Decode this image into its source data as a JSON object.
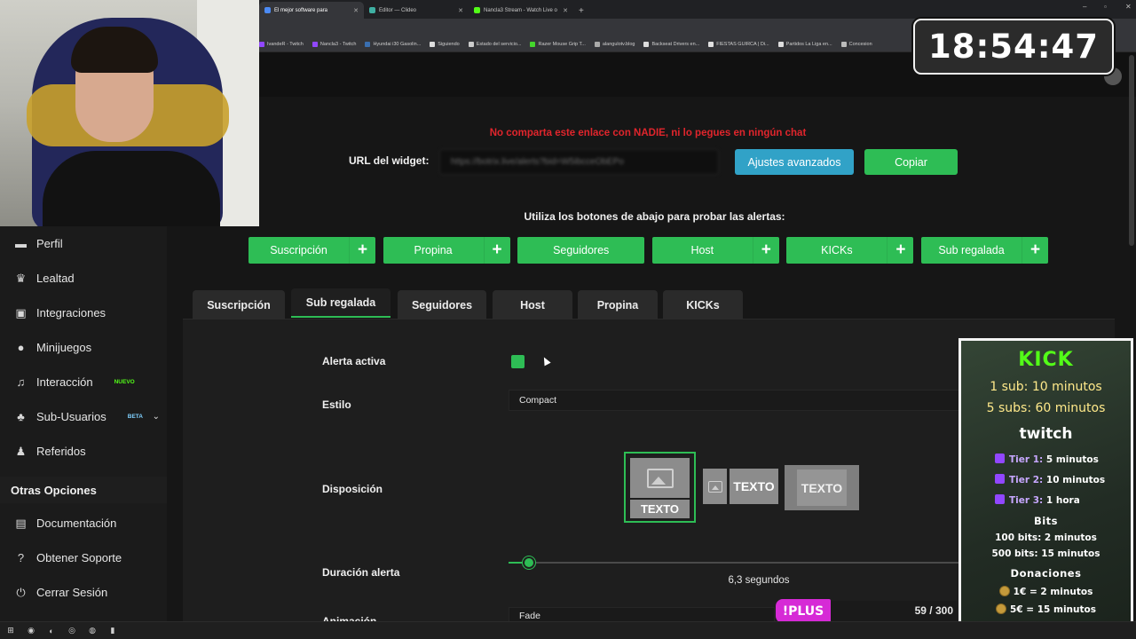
{
  "browser": {
    "tabs": [
      {
        "label": "El mejor software para",
        "color": "#4c8bf5",
        "active": true
      },
      {
        "label": "Editor — Clideo",
        "color": "#3fb0a3",
        "active": false
      },
      {
        "label": "Nancla3 Stream - Watch Live o",
        "color": "#53fc18",
        "active": false
      }
    ],
    "new_tab": "+",
    "window_controls": [
      "–",
      "▫",
      "✕"
    ]
  },
  "bookmarks": [
    {
      "label": "IvandeR - Twitch",
      "color": "#9147ff"
    },
    {
      "label": "Nancla3 - Twitch",
      "color": "#9147ff"
    },
    {
      "label": "Hyundai i30 Gasolin...",
      "color": "#3a6fb0"
    },
    {
      "label": "Siguiendo",
      "color": "#dddddd"
    },
    {
      "label": "Estado del servicio...",
      "color": "#cccccc"
    },
    {
      "label": "Razer Mouse Grip T...",
      "color": "#44d62c"
    },
    {
      "label": "alangulotv.blog",
      "color": "#aaaaaa"
    },
    {
      "label": "Backseat Drivers en...",
      "color": "#dddddd"
    },
    {
      "label": "FIESTAS GUIRCA | Di...",
      "color": "#e0e0e0"
    },
    {
      "label": "Partidos La Liga en...",
      "color": "#dddddd"
    },
    {
      "label": "Concesion",
      "color": "#bbbbbb"
    }
  ],
  "sidebar": {
    "items": [
      {
        "label": "Perfil",
        "icon": "id-card-icon",
        "glyph": "▬"
      },
      {
        "label": "Lealtad",
        "icon": "trophy-icon",
        "glyph": "♛"
      },
      {
        "label": "Integraciones",
        "icon": "plug-icon",
        "glyph": "▣"
      },
      {
        "label": "Minijuegos",
        "icon": "gamepad-icon",
        "glyph": "●"
      },
      {
        "label": "Interacción",
        "icon": "music-icon",
        "glyph": "♫",
        "badge": "NUEVO"
      },
      {
        "label": "Sub-Usuarios",
        "icon": "users-icon",
        "glyph": "♣",
        "badge": "BETA",
        "expandable": true
      },
      {
        "label": "Referidos",
        "icon": "user-group-icon",
        "glyph": "♟"
      }
    ],
    "section_title": "Otras Opciones",
    "bottom_items": [
      {
        "label": "Documentación",
        "icon": "document-icon",
        "glyph": "▤"
      },
      {
        "label": "Obtener Soporte",
        "icon": "question-circle-icon",
        "glyph": "?"
      },
      {
        "label": "Cerrar Sesión",
        "icon": "power-icon",
        "glyph": "⏻"
      }
    ]
  },
  "widget": {
    "warning": "No comparta este enlace con NADIE, ni lo pegues en ningún chat",
    "url_label": "URL del widget:",
    "url_value": "https://botrix.live/alerts?bid=W5ibcceObEPo",
    "advanced_button": "Ajustes avanzados",
    "copy_button": "Copiar",
    "test_hint": "Utiliza los botones de abajo para probar las alertas:"
  },
  "test_buttons": [
    "Suscripción",
    "Propina",
    "Seguidores",
    "Host",
    "KICKs",
    "Sub regalada"
  ],
  "alert_tabs": [
    "Suscripción",
    "Sub regalada",
    "Seguidores",
    "Host",
    "Propina",
    "KICKs"
  ],
  "active_alert_tab": "Sub regalada",
  "settings": {
    "active_label": "Alerta activa",
    "active_checked": true,
    "style_label": "Estilo",
    "style_value": "Compact",
    "layout_label": "Disposición",
    "layout_text": "TEXTO",
    "layout_selected": 0,
    "duration_label": "Duración alerta",
    "duration_value": 6.3,
    "duration_display": "6,3  segundos",
    "duration_fraction": 0.045,
    "animation_label": "Animación",
    "animation_value": "Fade"
  },
  "overlay": {
    "clock": "18:54:47",
    "kick_title": "KICK",
    "kick_line1": "1 sub: 10 minutos",
    "kick_line2": "5 subs: 60 minutos",
    "twitch_title": "twitch",
    "tier1": "Tier 1:",
    "tier1_val": " 5 minutos",
    "tier2": "Tier 2:",
    "tier2_val": " 10 minutos",
    "tier3": "Tier 3:",
    "tier3_val": " 1 hora",
    "bits_title": "Bits",
    "bits1": "100 bits: 2 minutos",
    "bits2": "500 bits: 15 minutos",
    "donations_title": "Donaciones",
    "don1": "1€ = 2 minutos",
    "don2": "5€ = 15 minutos",
    "plus_badge": "!PLUS",
    "plus_count": "59 / 300"
  },
  "taskbar": {
    "icons": [
      {
        "name": "windows-start-icon",
        "glyph": "⊞"
      },
      {
        "name": "chrome-icon",
        "glyph": "◉"
      },
      {
        "name": "steam-icon",
        "glyph": "◐"
      },
      {
        "name": "obs-icon",
        "glyph": "◎"
      },
      {
        "name": "app-icon",
        "glyph": "◍"
      },
      {
        "name": "folder-icon",
        "glyph": "▮"
      }
    ]
  }
}
